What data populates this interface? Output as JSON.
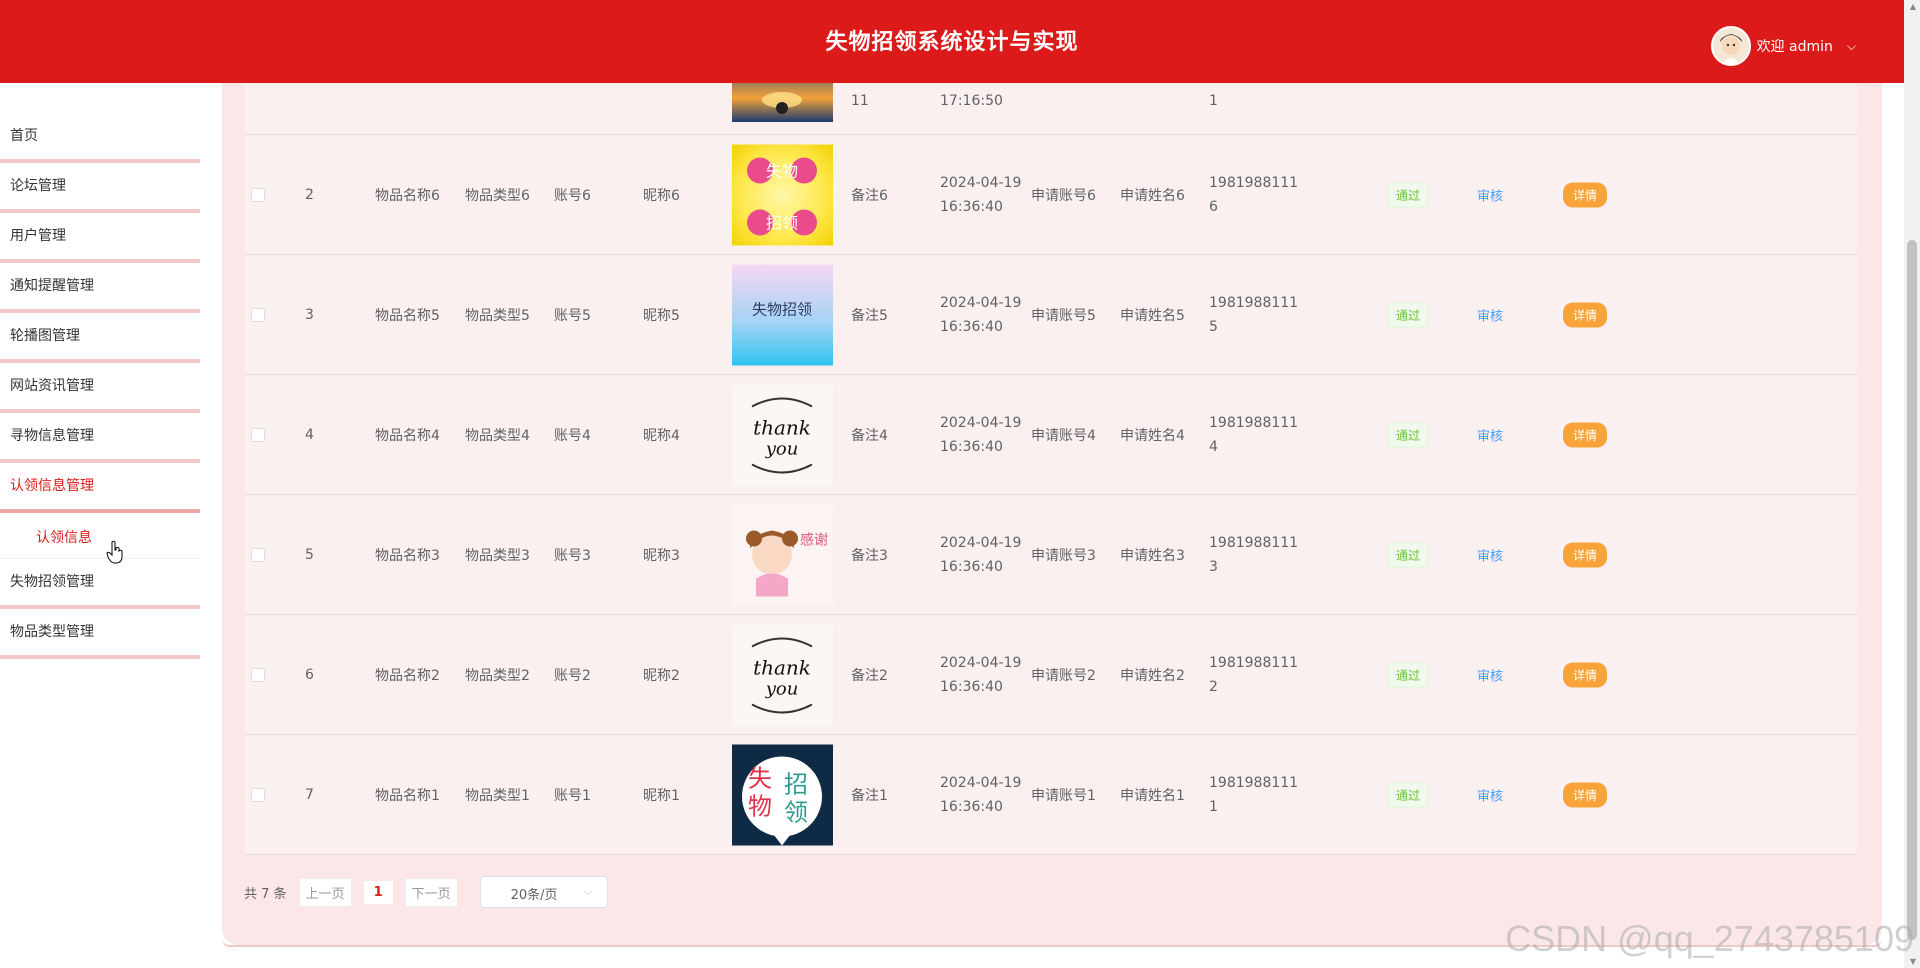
{
  "header": {
    "title": "失物招领系统设计与实现",
    "user_greeting": "欢迎 admin"
  },
  "sidebar": {
    "items": [
      {
        "label": "首页"
      },
      {
        "label": "论坛管理"
      },
      {
        "label": "用户管理"
      },
      {
        "label": "通知提醒管理"
      },
      {
        "label": "轮播图管理"
      },
      {
        "label": "网站资讯管理"
      },
      {
        "label": "寻物信息管理"
      },
      {
        "label": "认领信息管理"
      },
      {
        "label": "失物招领管理"
      },
      {
        "label": "物品类型管理"
      }
    ],
    "active_index": 7,
    "submenu": {
      "label": "认领信息"
    }
  },
  "table": {
    "partial_row": {
      "time": "17:16:50",
      "col_a": "11",
      "phone_tail": "1"
    },
    "rows": [
      {
        "index": "2",
        "name": "物品名称6",
        "type": "物品类型6",
        "account": "账号6",
        "nickname": "昵称6",
        "image": "失物招领 sticker",
        "remark": "备注6",
        "date": "2024-04-19",
        "time": "16:36:40",
        "apply_account": "申请账号6",
        "apply_name": "申请姓名6",
        "phone": "1981988111",
        "phone_tail": "6",
        "status": "通过",
        "audit": "审核",
        "detail": "详情"
      },
      {
        "index": "3",
        "name": "物品名称5",
        "type": "物品类型5",
        "account": "账号5",
        "nickname": "昵称5",
        "image": "失物招领 gradient",
        "remark": "备注5",
        "date": "2024-04-19",
        "time": "16:36:40",
        "apply_account": "申请账号5",
        "apply_name": "申请姓名5",
        "phone": "1981988111",
        "phone_tail": "5",
        "status": "通过",
        "audit": "审核",
        "detail": "详情"
      },
      {
        "index": "4",
        "name": "物品名称4",
        "type": "物品类型4",
        "account": "账号4",
        "nickname": "昵称4",
        "image": "thank you",
        "remark": "备注4",
        "date": "2024-04-19",
        "time": "16:36:40",
        "apply_account": "申请账号4",
        "apply_name": "申请姓名4",
        "phone": "1981988111",
        "phone_tail": "4",
        "status": "通过",
        "audit": "审核",
        "detail": "详情"
      },
      {
        "index": "5",
        "name": "物品名称3",
        "type": "物品类型3",
        "account": "账号3",
        "nickname": "昵称3",
        "image": "感谢 girl",
        "remark": "备注3",
        "date": "2024-04-19",
        "time": "16:36:40",
        "apply_account": "申请账号3",
        "apply_name": "申请姓名3",
        "phone": "1981988111",
        "phone_tail": "3",
        "status": "通过",
        "audit": "审核",
        "detail": "详情"
      },
      {
        "index": "6",
        "name": "物品名称2",
        "type": "物品类型2",
        "account": "账号2",
        "nickname": "昵称2",
        "image": "thank you",
        "remark": "备注2",
        "date": "2024-04-19",
        "time": "16:36:40",
        "apply_account": "申请账号2",
        "apply_name": "申请姓名2",
        "phone": "1981988111",
        "phone_tail": "2",
        "status": "通过",
        "audit": "审核",
        "detail": "详情"
      },
      {
        "index": "7",
        "name": "物品名称1",
        "type": "物品类型1",
        "account": "账号1",
        "nickname": "昵称1",
        "image": "失物招领 dark",
        "remark": "备注1",
        "date": "2024-04-19",
        "time": "16:36:40",
        "apply_account": "申请账号1",
        "apply_name": "申请姓名1",
        "phone": "1981988111",
        "phone_tail": "1",
        "status": "通过",
        "audit": "审核",
        "detail": "详情"
      }
    ]
  },
  "pagination": {
    "total": "共 7 条",
    "prev": "上一页",
    "current": "1",
    "next": "下一页",
    "page_size": "20条/页"
  },
  "images": {
    "sticker_text_a": "失物",
    "sticker_text_b": "招领",
    "gradient_text": "失物招领",
    "thanks_1": "thank",
    "thanks_2": "you",
    "girl_text": "感谢",
    "dark_a": "失",
    "dark_b": "物",
    "dark_c": "招",
    "dark_d": "领"
  },
  "watermark": "CSDN @qq_2743785109",
  "colors": {
    "brand": "#dc1a1a",
    "panel": "#fbe7e7",
    "success": "#67c23a",
    "link": "#409eff",
    "detail": "#f7a33a"
  }
}
